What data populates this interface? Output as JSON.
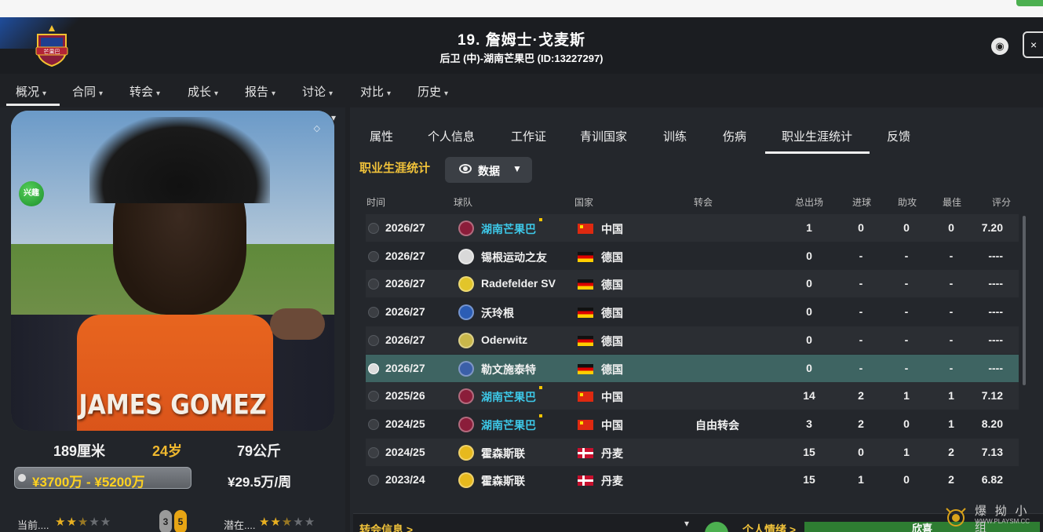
{
  "header": {
    "title": "19. 詹姆士·戈麦斯",
    "subtitle": "后卫 (中)-湖南芒果巴 (ID:13227297)",
    "badge_text": "芒果巴"
  },
  "nav": {
    "items": [
      {
        "label": "概况"
      },
      {
        "label": "合同"
      },
      {
        "label": "转会"
      },
      {
        "label": "成长"
      },
      {
        "label": "报告"
      },
      {
        "label": "讨论"
      },
      {
        "label": "对比"
      },
      {
        "label": "历史"
      }
    ]
  },
  "profile": {
    "photo_name": "JAMES GOMEZ",
    "interest_badge": "兴趣",
    "height": "189厘米",
    "age": "24岁",
    "weight": "79公斤",
    "value_range": "¥3700万 - ¥5200万",
    "wage": "¥29.5万/周",
    "current_label": "当前....",
    "potential_label": "潜在....",
    "current_stars": 2.5,
    "potential_stars": 2.5,
    "current_ability": "3",
    "potential_ability": "5"
  },
  "subtabs": {
    "items": [
      {
        "label": "属性"
      },
      {
        "label": "个人信息"
      },
      {
        "label": "工作证"
      },
      {
        "label": "青训国家"
      },
      {
        "label": "训练"
      },
      {
        "label": "伤病"
      },
      {
        "label": "职业生涯统计"
      },
      {
        "label": "反馈"
      }
    ],
    "active": "职业生涯统计"
  },
  "career": {
    "section_title": "职业生涯统计",
    "view_button": "数据",
    "columns": {
      "season": "时间",
      "club": "球队",
      "nation": "国家",
      "transfer": "转会",
      "apps": "总出场",
      "goals": "进球",
      "assists": "助攻",
      "motm": "最佳",
      "rating": "评分"
    },
    "rows": [
      {
        "season": "2026/27",
        "club": "湖南芒果巴",
        "nation": "中国",
        "flag": "cn",
        "transfer": "",
        "apps": "1",
        "goals": "0",
        "assists": "0",
        "motm": "0",
        "rating": "7.20",
        "highlight": true,
        "icon_color": "#8b1d3a"
      },
      {
        "season": "2026/27",
        "club": "锡根运动之友",
        "nation": "德国",
        "flag": "de",
        "transfer": "",
        "apps": "0",
        "goals": "-",
        "assists": "-",
        "motm": "-",
        "rating": "----",
        "highlight": false,
        "icon_color": "#d9d9d9"
      },
      {
        "season": "2026/27",
        "club": "Radefelder SV",
        "nation": "德国",
        "flag": "de",
        "transfer": "",
        "apps": "0",
        "goals": "-",
        "assists": "-",
        "motm": "-",
        "rating": "----",
        "highlight": false,
        "icon_color": "#e2c52a"
      },
      {
        "season": "2026/27",
        "club": "沃玲根",
        "nation": "德国",
        "flag": "de",
        "transfer": "",
        "apps": "0",
        "goals": "-",
        "assists": "-",
        "motm": "-",
        "rating": "----",
        "highlight": false,
        "icon_color": "#2b5db5"
      },
      {
        "season": "2026/27",
        "club": "Oderwitz",
        "nation": "德国",
        "flag": "de",
        "transfer": "",
        "apps": "0",
        "goals": "-",
        "assists": "-",
        "motm": "-",
        "rating": "----",
        "highlight": false,
        "icon_color": "#c9b74a"
      },
      {
        "season": "2026/27",
        "club": "勒文施泰特",
        "nation": "德国",
        "flag": "de",
        "transfer": "",
        "apps": "0",
        "goals": "-",
        "assists": "-",
        "motm": "-",
        "rating": "----",
        "highlight": false,
        "icon_color": "#3b5fa8"
      },
      {
        "season": "2025/26",
        "club": "湖南芒果巴",
        "nation": "中国",
        "flag": "cn",
        "transfer": "",
        "apps": "14",
        "goals": "2",
        "assists": "1",
        "motm": "1",
        "rating": "7.12",
        "highlight": true,
        "icon_color": "#8b1d3a"
      },
      {
        "season": "2024/25",
        "club": "湖南芒果巴",
        "nation": "中国",
        "flag": "cn",
        "transfer": "自由转会",
        "apps": "3",
        "goals": "2",
        "assists": "0",
        "motm": "1",
        "rating": "8.20",
        "highlight": true,
        "icon_color": "#8b1d3a"
      },
      {
        "season": "2024/25",
        "club": "霍森斯联",
        "nation": "丹麦",
        "flag": "dk",
        "transfer": "",
        "apps": "15",
        "goals": "0",
        "assists": "1",
        "motm": "2",
        "rating": "7.13",
        "highlight": false,
        "icon_color": "#e7b91d"
      },
      {
        "season": "2023/24",
        "club": "霍森斯联",
        "nation": "丹麦",
        "flag": "dk",
        "transfer": "",
        "apps": "15",
        "goals": "1",
        "assists": "0",
        "motm": "2",
        "rating": "6.82",
        "highlight": false,
        "icon_color": "#e7b91d"
      }
    ],
    "selected_row": 5
  },
  "bottom": {
    "transfer_info": "转会信息 >",
    "personal_mood": "个人情绪 >",
    "mood_value": "欣喜"
  },
  "watermark": {
    "cn": "爆 拗 小 组",
    "en": "WWW.PLAYSM.CC"
  },
  "colors": {
    "accent_yellow": "#f0c23a",
    "club_cyan": "#3dc8e8",
    "selected_row": "#3e6462",
    "value_gold": "#ffd21f"
  }
}
